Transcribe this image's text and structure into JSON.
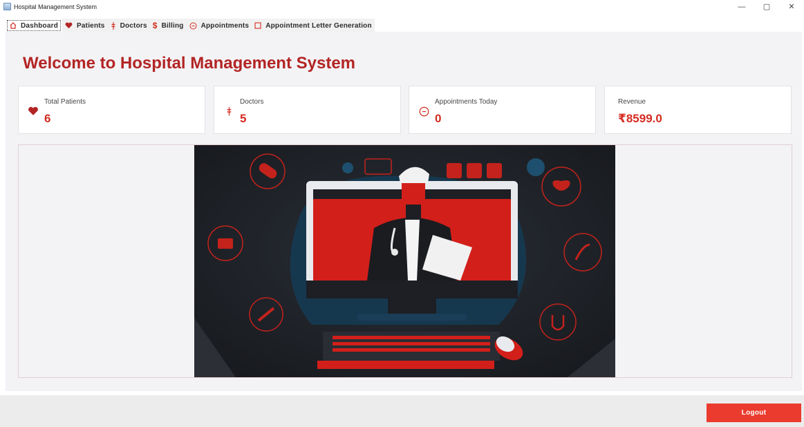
{
  "window": {
    "title": "Hospital Management System",
    "controls": [
      "—",
      "▢",
      "✕"
    ]
  },
  "tabs": [
    {
      "label": "Dashboard",
      "icon": "house-icon",
      "active": true
    },
    {
      "label": "Patients",
      "icon": "heart-icon"
    },
    {
      "label": "Doctors",
      "icon": "caduceus-icon"
    },
    {
      "label": "Billing",
      "icon": "dollar-icon"
    },
    {
      "label": "Appointments",
      "icon": "minus-circle-icon"
    },
    {
      "label": "Appointment Letter Generation",
      "icon": "square-icon"
    }
  ],
  "dashboard": {
    "welcome": "Welcome to Hospital Management System",
    "cards": [
      {
        "label": "Total Patients",
        "value": "6",
        "icon": "heart-icon"
      },
      {
        "label": "Doctors",
        "value": "5",
        "icon": "caduceus-icon"
      },
      {
        "label": "Appointments Today",
        "value": "0",
        "icon": "minus-circle-icon"
      },
      {
        "label": "Revenue",
        "value": "₹8599.0"
      }
    ],
    "accent_color": "#d42b20",
    "title_color": "#b32424"
  },
  "footer": {
    "logout_label": "Logout",
    "logout_color": "#ea3b2e"
  }
}
